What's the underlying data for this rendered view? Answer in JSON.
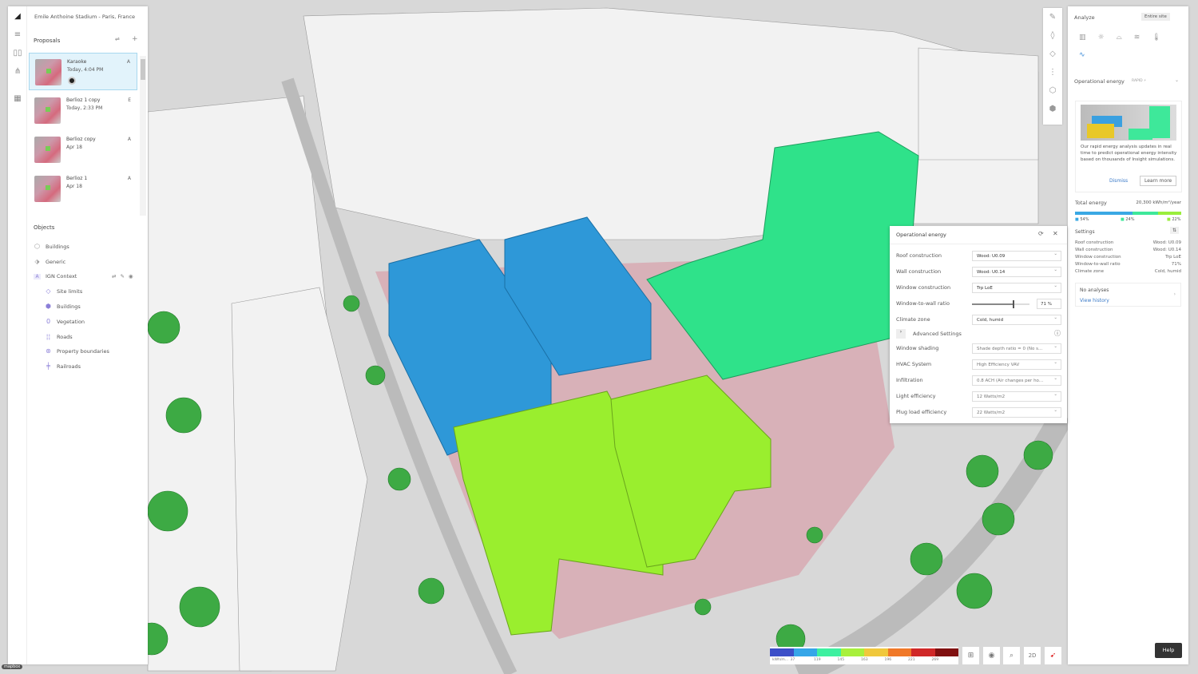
{
  "project_title": "Emile Anthoine Stadium - Paris, France",
  "proposals": {
    "heading": "Proposals",
    "items": [
      {
        "name": "Karaoke",
        "date": "Today, 4:04 PM",
        "badge": "A",
        "selected": true
      },
      {
        "name": "Berlioz 1 copy",
        "date": "Today, 2:33 PM",
        "badge": "E"
      },
      {
        "name": "Berlioz copy",
        "date": "Apr 18",
        "badge": "A"
      },
      {
        "name": "Berlioz 1",
        "date": "Apr 18",
        "badge": "A"
      }
    ]
  },
  "objects": {
    "heading": "Objects",
    "items": [
      {
        "label": "Buildings",
        "icon": "cube-icon"
      },
      {
        "label": "Generic",
        "icon": "shapes-icon"
      },
      {
        "label": "IGN Context",
        "icon": "letter-a-icon",
        "badge": "A"
      }
    ],
    "children": [
      {
        "label": "Site limits",
        "icon": "site-limits-icon"
      },
      {
        "label": "Buildings",
        "icon": "cube-icon"
      },
      {
        "label": "Vegetation",
        "icon": "tree-icon"
      },
      {
        "label": "Roads",
        "icon": "road-icon"
      },
      {
        "label": "Property boundaries",
        "icon": "boundary-icon"
      },
      {
        "label": "Railroads",
        "icon": "railroad-icon"
      }
    ]
  },
  "analyze": {
    "heading": "Analyze",
    "scope": "Entire site",
    "section": "Operational energy",
    "tag": "RAPID ⚡",
    "promo": "Our rapid energy analysis updates in real time to predict operational energy intensity based on thousands of Insight simulations.",
    "dismiss": "Dismiss",
    "learn_more": "Learn more",
    "total_label": "Total energy",
    "total_value": "20,300 kWh/m²/year",
    "shares": [
      {
        "pct": "54%",
        "color": "#3aa8e4",
        "value": 54
      },
      {
        "pct": "24%",
        "color": "#3ee89a",
        "value": 24
      },
      {
        "pct": "22%",
        "color": "#9aee3c",
        "value": 22
      }
    ],
    "settings_label": "Settings",
    "settings": [
      [
        "Roof construction",
        "Wood: U0.09"
      ],
      [
        "Wall construction",
        "Wood: U0.14"
      ],
      [
        "Window construction",
        "Trp LoE"
      ],
      [
        "Window-to-wall ratio",
        "71%"
      ],
      [
        "Climate zone",
        "Cold, humid"
      ]
    ],
    "no_analyses": "No analyses",
    "view_history": "View history"
  },
  "dialog": {
    "title": "Operational energy",
    "fields": [
      [
        "Roof construction",
        "Wood: U0.09"
      ],
      [
        "Wall construction",
        "Wood: U0.14"
      ],
      [
        "Window construction",
        "Trp LoE"
      ]
    ],
    "wwr_label": "Window-to-wall ratio",
    "wwr_value": "71",
    "wwr_unit": "%",
    "wwr": 71,
    "climate_label": "Climate zone",
    "climate_value": "Cold, humid",
    "advanced": "Advanced Settings",
    "adv_fields": [
      [
        "Window shading",
        "Shade depth ratio = 0 (No s..."
      ],
      [
        "HVAC System",
        "High Efficiency VAV"
      ],
      [
        "Infiltration",
        "0.8 ACH (Air changes per ho..."
      ],
      [
        "Light efficiency",
        "12 Watts/m2"
      ],
      [
        "Plug load efficiency",
        "22 Watts/m2"
      ]
    ]
  },
  "legend": {
    "unit": "kWh/m...",
    "ticks": [
      "37",
      "119",
      "145",
      "163",
      "196",
      "221",
      "269"
    ],
    "colors": [
      "#3c4fc8",
      "#36a6e8",
      "#3ef0a0",
      "#a8f03c",
      "#f0c83c",
      "#f07828",
      "#d02828",
      "#801010"
    ]
  },
  "view_buttons": {
    "two_d": "2D"
  },
  "help": "Help",
  "attribution": "mapbox"
}
